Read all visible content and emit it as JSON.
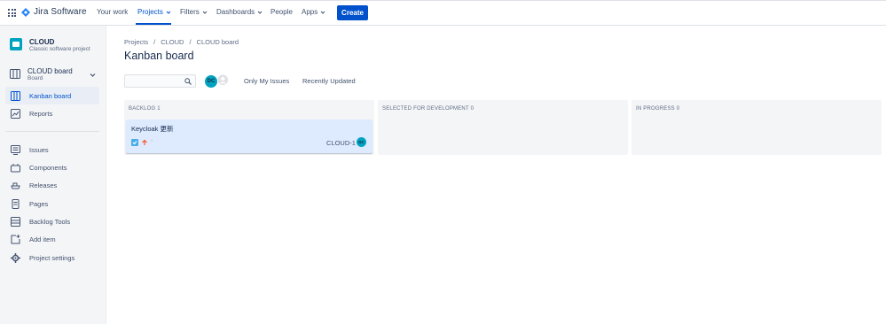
{
  "topnav": {
    "product_name": "Jira Software",
    "items": [
      {
        "label": "Your work",
        "has_chevron": false
      },
      {
        "label": "Projects",
        "has_chevron": true,
        "active": true
      },
      {
        "label": "Filters",
        "has_chevron": true
      },
      {
        "label": "Dashboards",
        "has_chevron": true
      },
      {
        "label": "People",
        "has_chevron": false
      },
      {
        "label": "Apps",
        "has_chevron": true
      }
    ],
    "create_label": "Create",
    "accent_color": "#0052cc"
  },
  "sidebar": {
    "project": {
      "name": "CLOUD",
      "type": "Classic software project"
    },
    "board": {
      "name": "CLOUD board",
      "subtitle": "Board"
    },
    "items": [
      {
        "label": "Kanban board",
        "icon": "board-icon",
        "selected": true
      },
      {
        "label": "Reports",
        "icon": "reports-icon"
      },
      {
        "label": "Issues",
        "icon": "issues-icon"
      },
      {
        "label": "Components",
        "icon": "components-icon"
      },
      {
        "label": "Releases",
        "icon": "releases-icon"
      },
      {
        "label": "Pages",
        "icon": "pages-icon"
      },
      {
        "label": "Backlog Tools",
        "icon": "backlog-tools-icon"
      },
      {
        "label": "Add item",
        "icon": "add-item-icon"
      },
      {
        "label": "Project settings",
        "icon": "gear-icon"
      }
    ]
  },
  "main": {
    "breadcrumb": [
      "Projects",
      "CLOUD",
      "CLOUD board"
    ],
    "title": "Kanban board",
    "search": {
      "placeholder": "",
      "value": ""
    },
    "avatar_initials": "DC",
    "filters": [
      "Only My Issues",
      "Recently Updated"
    ],
    "columns": [
      {
        "title": "BACKLOG 1"
      },
      {
        "title": "SELECTED FOR DEVELOPMENT 0"
      },
      {
        "title": "IN PROGRESS 0"
      }
    ],
    "card": {
      "title": "Keycloak 更新",
      "key": "CLOUD-1",
      "assignee_initials": "DC",
      "dash": "-"
    }
  }
}
